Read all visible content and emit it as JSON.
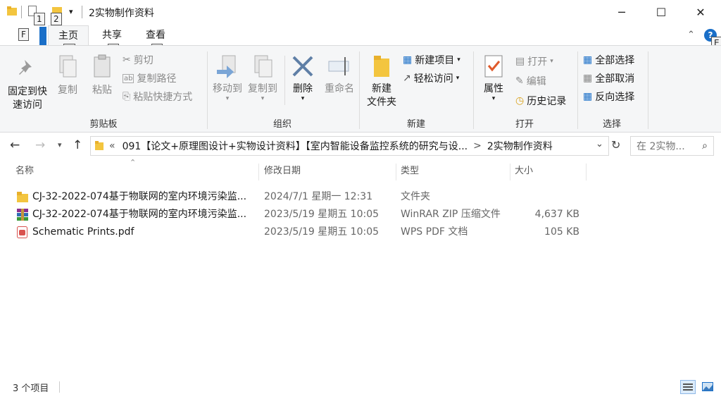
{
  "titlebar": {
    "title": "2实物制作资料",
    "keytips": [
      "1",
      "2"
    ],
    "controls": {
      "minimize": "─",
      "maximize": "☐",
      "close": "✕"
    }
  },
  "tabs": [
    {
      "label": "主页",
      "keytip": "H"
    },
    {
      "label": "共享",
      "keytip": "S"
    },
    {
      "label": "查看",
      "keytip": "V"
    }
  ],
  "file_keytip": "F",
  "help_keytip": "E",
  "ribbon": {
    "clipboard": {
      "pin": "固定到快\n速访问",
      "copy": "复制",
      "paste": "粘贴",
      "cut": "剪切",
      "copy_path": "复制路径",
      "paste_shortcut": "粘贴快捷方式",
      "label": "剪贴板"
    },
    "organize": {
      "move_to": "移动到",
      "copy_to": "复制到",
      "delete": "删除",
      "rename": "重命名",
      "label": "组织"
    },
    "new": {
      "new_folder": "新建\n文件夹",
      "new_item": "新建项目",
      "easy_access": "轻松访问",
      "label": "新建"
    },
    "open": {
      "properties": "属性",
      "open": "打开",
      "edit": "编辑",
      "history": "历史记录",
      "label": "打开"
    },
    "select": {
      "select_all": "全部选择",
      "select_none": "全部取消",
      "invert": "反向选择",
      "label": "选择"
    }
  },
  "address": {
    "prefix": "«",
    "path1": "091【论文+原理图设计+实物设计资料】【室内智能设备监控系统的研究与设...",
    "sep": ">",
    "path2": "2实物制作资料",
    "search_placeholder": "在 2实物..."
  },
  "columns": {
    "name": "名称",
    "modified": "修改日期",
    "type": "类型",
    "size": "大小"
  },
  "files": [
    {
      "name": "CJ-32-2022-074基于物联网的室内环境污染监...",
      "modified": "2024/7/1 星期一 12:31",
      "type": "文件夹",
      "size": "",
      "icon": "folder-icon"
    },
    {
      "name": "CJ-32-2022-074基于物联网的室内环境污染监...",
      "modified": "2023/5/19 星期五 10:05",
      "type": "WinRAR ZIP 压缩文件",
      "size": "4,637 KB",
      "icon": "winrar-icon"
    },
    {
      "name": "Schematic Prints.pdf",
      "modified": "2023/5/19 星期五 10:05",
      "type": "WPS PDF 文档",
      "size": "105 KB",
      "icon": "pdf-icon"
    }
  ],
  "status": {
    "count": "3 个项目"
  }
}
